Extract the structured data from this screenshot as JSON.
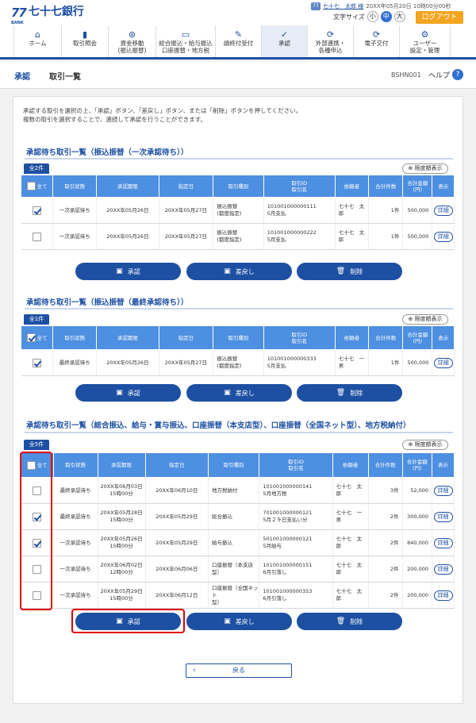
{
  "header": {
    "logo_mark": "77",
    "logo_sub": "BANK",
    "bank_name": "七十七銀行",
    "user_icon": "77",
    "user_name": "七十七　太郎 様",
    "last_login": "20XX年05月20日 10時00分00秒",
    "font_size_label": "文字サイズ",
    "font_sizes": [
      "小",
      "中",
      "大"
    ],
    "logout": "ログアウト"
  },
  "nav": [
    {
      "icon": "home-icon",
      "glyph": "⌂",
      "label": "ホーム"
    },
    {
      "icon": "account-icon",
      "glyph": "▮",
      "label": "取引照会"
    },
    {
      "icon": "transfer-icon",
      "glyph": "⊛",
      "label": "資金移動\n(振込振替)"
    },
    {
      "icon": "bulk-icon",
      "glyph": "▭",
      "label": "総合振込・給与振込\n口座振替・地方税"
    },
    {
      "icon": "request-icon",
      "glyph": "✎",
      "label": "請終付受付"
    },
    {
      "icon": "approve-icon",
      "glyph": "✓",
      "label": "承認"
    },
    {
      "icon": "link-icon",
      "glyph": "⟳",
      "label": "外部連携・\n各種申込"
    },
    {
      "icon": "edelivery-icon",
      "glyph": "⟳",
      "label": "電子交付"
    },
    {
      "icon": "user-settings-icon",
      "glyph": "⚙",
      "label": "ユーザー\n設定・管理"
    }
  ],
  "breadcrumb": {
    "section": "承認",
    "page": "取引一覧",
    "screen_code": "BSHN001",
    "help": "ヘルプ",
    "help_icon": "?"
  },
  "intro": [
    "承認する取引を選択の上、「承認」ボタン、「差戻し」ボタン、または「削除」ボタンを押してください。",
    "複数の取引を選択することで、連続して承認を行うことができます。"
  ],
  "common": {
    "all": "全て",
    "detail": "詳細",
    "limit_btn": "限度額表示",
    "btn_approve": "承認",
    "btn_return": "差戻し",
    "btn_delete": "削除",
    "back": "戻る"
  },
  "sections": [
    {
      "title": "承認待ち取引一覧（振込振替（一次承認待ち））",
      "count": "全2件",
      "all_checked": false,
      "headers": [
        "取引状態",
        "承認期限",
        "指定日",
        "取引種別",
        "取引ID\n取引名",
        "依頼者",
        "合計件数",
        "合計金額\n(円)",
        "表示"
      ],
      "rows": [
        {
          "checked": true,
          "status": "一次承認待ち",
          "deadline": "20XX年05月26日",
          "date": "20XX年05月27日",
          "type": "振込振替\n(都度指定)",
          "id": "101001000000111\n5月支払",
          "requester": "七十七　太郎",
          "count": "1件",
          "amount": "500,000"
        },
        {
          "checked": false,
          "status": "一次承認待ち",
          "deadline": "20XX年05月26日",
          "date": "20XX年05月27日",
          "type": "振込振替\n(都度指定)",
          "id": "101001000000222\n5月支払",
          "requester": "七十七　太郎",
          "count": "1件",
          "amount": "500,000"
        }
      ]
    },
    {
      "title": "承認待ち取引一覧（振込振替（最終承認待ち））",
      "count": "全1件",
      "all_checked": true,
      "headers": [
        "取引状態",
        "承認期限",
        "指定日",
        "取引種別",
        "取引ID\n取引名",
        "依頼者",
        "合計件数",
        "合計金額\n(円)",
        "表示"
      ],
      "rows": [
        {
          "checked": true,
          "status": "最終承認待ち",
          "deadline": "20XX年05月26日",
          "date": "20XX年05月27日",
          "type": "振込振替\n(都度指定)",
          "id": "101001000000333\n5月支払",
          "requester": "七十七　一男",
          "count": "1件",
          "amount": "500,000"
        }
      ]
    },
    {
      "title": "承認待ち取引一覧（総合振込、給与・賞与振込、口座振替（本支店型）、口座振替（全国ネット型）、地方税納付）",
      "count": "全5件",
      "all_checked": false,
      "headers": [
        "取引状態",
        "承認期限",
        "指定日",
        "取引種別",
        "取引ID\n取引名",
        "依頼者",
        "合計件数",
        "合計金額\n(円)",
        "表示"
      ],
      "rows": [
        {
          "checked": false,
          "status": "最終承認待ち",
          "deadline": "20XX年06月03日\n15時00分",
          "date": "20XX年06月10日",
          "type": "地方税納付",
          "id": "101001000000141\n5月地方税",
          "requester": "七十七　太\n郎",
          "count": "3件",
          "amount": "52,000"
        },
        {
          "checked": true,
          "status": "最終承認待ち",
          "deadline": "20XX年05月28日\n15時00分",
          "date": "20XX年05月29日",
          "type": "総合振込",
          "id": "701001000000121\n5月２９日支払い分",
          "requester": "七十七　一\n男",
          "count": "2件",
          "amount": "300,000"
        },
        {
          "checked": true,
          "status": "一次承認待ち",
          "deadline": "20XX年05月26日\n15時00分",
          "date": "20XX年05月29日",
          "type": "給与振込",
          "id": "501001000000121\n5月給与",
          "requester": "七十七　太\n郎",
          "count": "2件",
          "amount": "840,000"
        },
        {
          "checked": false,
          "status": "一次承認待ち",
          "deadline": "20XX年06月02日\n12時00分",
          "date": "20XX年06月06日",
          "type": "口座振替（本支店型）",
          "id": "101001000000151\n6月引落し",
          "requester": "七十七　太\n郎",
          "count": "2件",
          "amount": "200,000"
        },
        {
          "checked": false,
          "status": "一次承認待ち",
          "deadline": "20XX年05月29日\n15時00分",
          "date": "20XX年06月12日",
          "type": "口座振替（全国ネット\n型）",
          "id": "101001000000353\n6月引落し",
          "requester": "七十七　太\n郎",
          "count": "2件",
          "amount": "200,000"
        }
      ]
    }
  ]
}
